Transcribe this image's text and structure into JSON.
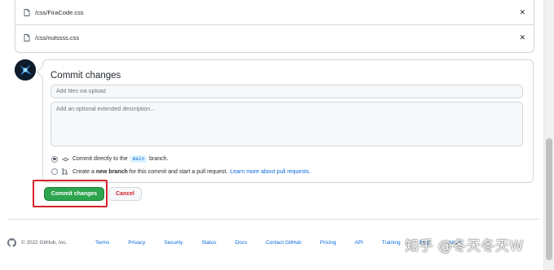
{
  "files": [
    {
      "name": "/css/FiraCode.css"
    },
    {
      "name": "/css/nutssss.css"
    }
  ],
  "commit": {
    "title": "Commit changes",
    "summary_placeholder": "Add files via upload",
    "description_placeholder": "Add an optional extended description...",
    "option_direct": {
      "prefix": "Commit directly to the",
      "branch": "main",
      "suffix": "branch."
    },
    "option_new": {
      "prefix": "Create a",
      "bold": "new branch",
      "suffix": "for this commit and start a pull request.",
      "link": "Learn more about pull requests."
    },
    "commit_button": "Commit changes",
    "cancel_button": "Cancel"
  },
  "footer": {
    "copyright": "© 2022 GitHub, Inc.",
    "links": [
      "Terms",
      "Privacy",
      "Security",
      "Status",
      "Docs",
      "Contact GitHub",
      "Pricing",
      "API",
      "Training",
      "Blog",
      "About"
    ]
  },
  "watermark": "知乎 @冬天冬天W",
  "colors": {
    "accent": "#2da44e",
    "link": "#0969da",
    "danger": "#cf222e",
    "highlight": "#d8222a"
  }
}
